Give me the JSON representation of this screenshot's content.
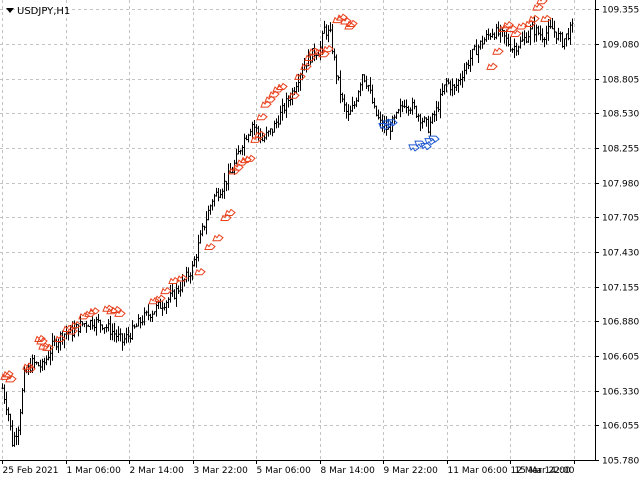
{
  "chart_data": {
    "type": "bar",
    "symbol_label": "USDJPY,H1",
    "grid": true,
    "ylim": [
      105.78,
      109.43
    ],
    "y_ticks": [
      "109.355",
      "109.080",
      "108.805",
      "108.530",
      "108.255",
      "107.980",
      "107.705",
      "107.430",
      "107.155",
      "106.880",
      "106.605",
      "106.330",
      "106.055",
      "105.780"
    ],
    "x_ticks": [
      "25 Feb 2021",
      "1 Mar 06:00",
      "2 Mar 14:00",
      "3 Mar 22:00",
      "5 Mar 06:00",
      "8 Mar 14:00",
      "9 Mar 22:00",
      "11 Mar 06:00",
      "12 Mar 14:00",
      "15 Mar 22:00"
    ],
    "close_path": [
      [
        0,
        106.35
      ],
      [
        6,
        106.15
      ],
      [
        10,
        105.92
      ],
      [
        16,
        106.05
      ],
      [
        22,
        106.45
      ],
      [
        30,
        106.55
      ],
      [
        40,
        106.52
      ],
      [
        50,
        106.68
      ],
      [
        60,
        106.78
      ],
      [
        70,
        106.8
      ],
      [
        80,
        106.86
      ],
      [
        90,
        106.88
      ],
      [
        100,
        106.86
      ],
      [
        110,
        106.8
      ],
      [
        120,
        106.72
      ],
      [
        130,
        106.8
      ],
      [
        140,
        106.9
      ],
      [
        150,
        106.96
      ],
      [
        160,
        107.02
      ],
      [
        170,
        107.08
      ],
      [
        180,
        107.18
      ],
      [
        190,
        107.3
      ],
      [
        200,
        107.6
      ],
      [
        210,
        107.85
      ],
      [
        220,
        107.95
      ],
      [
        230,
        108.08
      ],
      [
        240,
        108.3
      ],
      [
        250,
        108.45
      ],
      [
        260,
        108.32
      ],
      [
        270,
        108.4
      ],
      [
        280,
        108.55
      ],
      [
        290,
        108.7
      ],
      [
        300,
        108.9
      ],
      [
        310,
        109.0
      ],
      [
        318,
        109.05
      ],
      [
        322,
        109.2
      ],
      [
        328,
        109.15
      ],
      [
        334,
        108.85
      ],
      [
        340,
        108.62
      ],
      [
        346,
        108.5
      ],
      [
        352,
        108.6
      ],
      [
        360,
        108.85
      ],
      [
        366,
        108.75
      ],
      [
        372,
        108.55
      ],
      [
        378,
        108.45
      ],
      [
        386,
        108.4
      ],
      [
        394,
        108.5
      ],
      [
        402,
        108.62
      ],
      [
        410,
        108.58
      ],
      [
        418,
        108.5
      ],
      [
        426,
        108.42
      ],
      [
        434,
        108.55
      ],
      [
        444,
        108.78
      ],
      [
        452,
        108.72
      ],
      [
        460,
        108.85
      ],
      [
        470,
        109.0
      ],
      [
        480,
        109.1
      ],
      [
        490,
        109.18
      ],
      [
        500,
        109.15
      ],
      [
        510,
        109.05
      ],
      [
        520,
        109.1
      ],
      [
        530,
        109.2
      ],
      [
        540,
        109.15
      ],
      [
        550,
        109.2
      ],
      [
        560,
        109.1
      ],
      [
        571,
        109.22
      ]
    ],
    "up_arrows": [
      [
        2,
        106.42
      ],
      [
        4,
        106.44
      ],
      [
        7,
        106.4
      ],
      [
        24,
        106.5
      ],
      [
        26,
        106.48
      ],
      [
        36,
        106.72
      ],
      [
        38,
        106.7
      ],
      [
        40,
        106.66
      ],
      [
        44,
        106.65
      ],
      [
        56,
        106.72
      ],
      [
        64,
        106.8
      ],
      [
        68,
        106.78
      ],
      [
        72,
        106.83
      ],
      [
        80,
        106.9
      ],
      [
        86,
        106.92
      ],
      [
        90,
        106.94
      ],
      [
        104,
        106.96
      ],
      [
        108,
        106.94
      ],
      [
        112,
        106.95
      ],
      [
        116,
        106.92
      ],
      [
        150,
        107.02
      ],
      [
        156,
        107.04
      ],
      [
        162,
        107.1
      ],
      [
        170,
        107.18
      ],
      [
        178,
        107.2
      ],
      [
        196,
        107.25
      ],
      [
        206,
        107.45
      ],
      [
        214,
        107.52
      ],
      [
        222,
        107.68
      ],
      [
        226,
        107.72
      ],
      [
        230,
        108.05
      ],
      [
        234,
        108.08
      ],
      [
        238,
        108.12
      ],
      [
        242,
        108.14
      ],
      [
        246,
        108.15
      ],
      [
        252,
        108.3
      ],
      [
        256,
        108.34
      ],
      [
        258,
        108.48
      ],
      [
        262,
        108.58
      ],
      [
        266,
        108.62
      ],
      [
        270,
        108.66
      ],
      [
        274,
        108.7
      ],
      [
        278,
        108.72
      ],
      [
        290,
        108.65
      ],
      [
        296,
        108.8
      ],
      [
        302,
        108.88
      ],
      [
        306,
        108.95
      ],
      [
        310,
        109.0
      ],
      [
        316,
        109.0
      ],
      [
        320,
        108.98
      ],
      [
        324,
        109.02
      ],
      [
        334,
        109.25
      ],
      [
        338,
        109.27
      ],
      [
        342,
        109.24
      ],
      [
        346,
        109.2
      ],
      [
        348,
        109.22
      ],
      [
        488,
        108.88
      ],
      [
        494,
        109.0
      ],
      [
        500,
        109.18
      ],
      [
        504,
        109.21
      ],
      [
        508,
        109.18
      ],
      [
        512,
        109.14
      ],
      [
        518,
        109.2
      ],
      [
        526,
        109.22
      ],
      [
        530,
        109.26
      ],
      [
        534,
        109.35
      ],
      [
        538,
        109.4
      ],
      [
        542,
        109.26
      ]
    ],
    "down_arrows": [
      [
        380,
        108.45
      ],
      [
        384,
        108.47
      ],
      [
        388,
        108.48
      ],
      [
        410,
        108.28
      ],
      [
        416,
        108.31
      ],
      [
        422,
        108.29
      ],
      [
        426,
        108.33
      ],
      [
        430,
        108.35
      ]
    ],
    "colors": {
      "bars": "#000000",
      "up_arrow": "#e8401c",
      "down_arrow": "#1f58d0",
      "grid": "#c3c3c3",
      "axis": "#000000"
    }
  }
}
